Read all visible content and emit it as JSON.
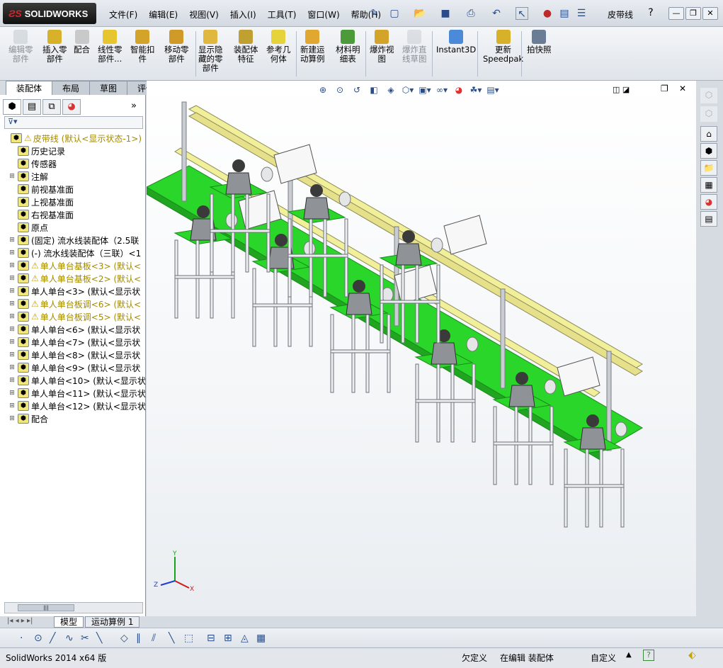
{
  "app": {
    "brand": "SOLIDWORKS",
    "document_title": "皮带线"
  },
  "menu": [
    "文件(F)",
    "编辑(E)",
    "视图(V)",
    "插入(I)",
    "工具(T)",
    "窗口(W)",
    "帮助(H)"
  ],
  "window_controls": {
    "help": "?",
    "minimize": "—",
    "restore": "❐",
    "close": "✕"
  },
  "commands": [
    {
      "label": "编辑零\n部件",
      "icon": "edit-component-icon",
      "disabled": true
    },
    {
      "label": "插入零\n部件",
      "icon": "insert-components-icon",
      "disabled": false
    },
    {
      "label": "配合",
      "icon": "mate-icon",
      "disabled": false
    },
    {
      "label": "线性零\n部件...",
      "icon": "linear-pattern-icon",
      "disabled": false
    },
    {
      "label": "智能扣\n件",
      "icon": "smart-fasteners-icon",
      "disabled": false
    },
    {
      "label": "移动零\n部件",
      "icon": "move-component-icon",
      "disabled": false
    },
    {
      "label": "显示隐\n藏的零\n部件",
      "icon": "show-hidden-icon",
      "disabled": false
    },
    {
      "label": "装配体\n特征",
      "icon": "assembly-features-icon",
      "disabled": false
    },
    {
      "label": "参考几\n何体",
      "icon": "reference-geometry-icon",
      "disabled": false
    },
    {
      "label": "新建运\n动算例",
      "icon": "new-motion-study-icon",
      "disabled": false
    },
    {
      "label": "材料明\n细表",
      "icon": "bom-icon",
      "disabled": false
    },
    {
      "label": "爆炸视\n图",
      "icon": "exploded-view-icon",
      "disabled": false
    },
    {
      "label": "爆炸直\n线草图",
      "icon": "explode-line-sketch-icon",
      "disabled": true
    },
    {
      "label": "Instant3D",
      "icon": "instant3d-icon",
      "disabled": false
    },
    {
      "label": "更新\nSpeedpak",
      "icon": "speedpak-icon",
      "disabled": false
    },
    {
      "label": "拍快照",
      "icon": "snapshot-icon",
      "disabled": false
    }
  ],
  "tabs": [
    "装配体",
    "布局",
    "草图",
    "评估"
  ],
  "tree": {
    "root": "皮带线  (默认<显示状态-1>)",
    "items": [
      {
        "label": "历史记录",
        "warn": false,
        "expand": false
      },
      {
        "label": "传感器",
        "warn": false,
        "expand": false
      },
      {
        "label": "注解",
        "warn": false,
        "expand": true
      },
      {
        "label": "前视基准面",
        "warn": false,
        "expand": false
      },
      {
        "label": "上视基准面",
        "warn": false,
        "expand": false
      },
      {
        "label": "右视基准面",
        "warn": false,
        "expand": false
      },
      {
        "label": "原点",
        "warn": false,
        "expand": false
      },
      {
        "label": "(固定) 流水线装配体（2.5联",
        "warn": false,
        "expand": true
      },
      {
        "label": "(-) 流水线装配体（三联）<1",
        "warn": false,
        "expand": true
      },
      {
        "label": "单人单台基板<3> (默认<",
        "warn": true,
        "expand": true
      },
      {
        "label": "单人单台基板<2> (默认<",
        "warn": true,
        "expand": true
      },
      {
        "label": "单人单台<3> (默认<显示状",
        "warn": false,
        "expand": true
      },
      {
        "label": "单人单台板调<6> (默认<",
        "warn": true,
        "expand": true
      },
      {
        "label": "单人单台板调<5> (默认<",
        "warn": true,
        "expand": true
      },
      {
        "label": "单人单台<6> (默认<显示状",
        "warn": false,
        "expand": true
      },
      {
        "label": "单人单台<7> (默认<显示状",
        "warn": false,
        "expand": true
      },
      {
        "label": "单人单台<8> (默认<显示状",
        "warn": false,
        "expand": true
      },
      {
        "label": "单人单台<9> (默认<显示状",
        "warn": false,
        "expand": true
      },
      {
        "label": "单人单台<10> (默认<显示状",
        "warn": false,
        "expand": true
      },
      {
        "label": "单人单台<11> (默认<显示状",
        "warn": false,
        "expand": true
      },
      {
        "label": "单人单台<12> (默认<显示状",
        "warn": false,
        "expand": true
      },
      {
        "label": "配合",
        "warn": false,
        "expand": true
      }
    ]
  },
  "bottom_tabs": [
    "模型",
    "运动算例 1"
  ],
  "status": {
    "version": "SolidWorks 2014 x64 版",
    "underdefined": "欠定义",
    "editing": "在编辑 装配体",
    "custom": "自定义"
  },
  "triad": {
    "x": "X",
    "y": "Y",
    "z": "Z"
  },
  "colors": {
    "belt_green": "#2bd62b",
    "frame_gray": "#c9cdd2",
    "rail_yellow": "#f2ef9a",
    "warning": "#c9a400"
  }
}
